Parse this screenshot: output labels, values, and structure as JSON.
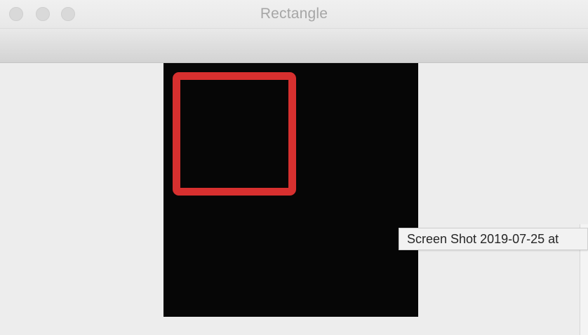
{
  "window": {
    "title": "Rectangle"
  },
  "drawing": {
    "background_color": "#060606",
    "shape": "rectangle",
    "stroke_color": "#d7302f"
  },
  "tooltip": {
    "text": "Screen Shot 2019-07-25 at"
  }
}
